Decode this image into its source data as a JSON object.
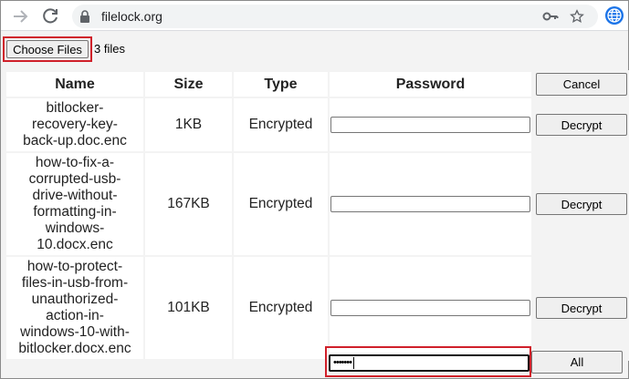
{
  "browser": {
    "url": "filelock.org"
  },
  "upload": {
    "choose_label": "Choose Files",
    "files_count": "3 files"
  },
  "table": {
    "headers": {
      "name": "Name",
      "size": "Size",
      "type": "Type",
      "password": "Password",
      "cancel_label": "Cancel"
    },
    "rows": [
      {
        "name_lines": [
          "bitlocker-",
          "recovery-key-",
          "back-up.doc.enc"
        ],
        "size": "1KB",
        "type": "Encrypted",
        "password": "",
        "action": "Decrypt"
      },
      {
        "name_lines": [
          "how-to-fix-a-",
          "corrupted-usb-",
          "drive-without-",
          "formatting-in-",
          "windows-",
          "10.docx.enc"
        ],
        "size": "167KB",
        "type": "Encrypted",
        "password": "",
        "action": "Decrypt"
      },
      {
        "name_lines": [
          "how-to-protect-",
          "files-in-usb-from-",
          "unauthorized-",
          "action-in-",
          "windows-10-with-",
          "bitlocker.docx.enc"
        ],
        "size": "101KB",
        "type": "Encrypted",
        "password": "",
        "action": "Decrypt"
      }
    ]
  },
  "footer": {
    "master_password_masked": "•••••••",
    "all_label": "All"
  },
  "colors": {
    "highlight": "#d0202a",
    "page_bg": "#f3f3f3"
  }
}
